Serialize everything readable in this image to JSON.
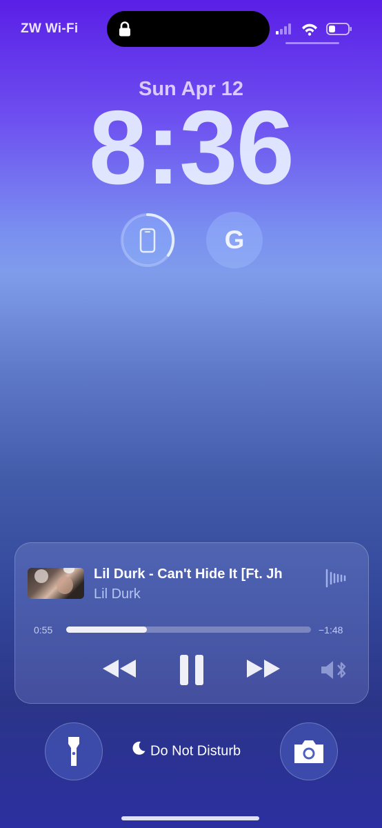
{
  "status": {
    "carrier": "ZW Wi-Fi"
  },
  "lockscreen": {
    "date": "Sun Apr 12",
    "time": "8:36"
  },
  "widgets": {
    "battery_icon": "phone-battery-ring",
    "google_label": "G"
  },
  "player": {
    "title": "Lil Durk - Can't Hide It [Ft. Jh",
    "artist": "Lil Durk",
    "elapsed": "0:55",
    "remaining": "−1:48",
    "progress": 0.33
  },
  "bottom": {
    "dnd_label": "Do Not Disturb"
  },
  "colors": {
    "accent_top": "#5a1fe6",
    "accent_bottom": "#2b2fa0"
  }
}
